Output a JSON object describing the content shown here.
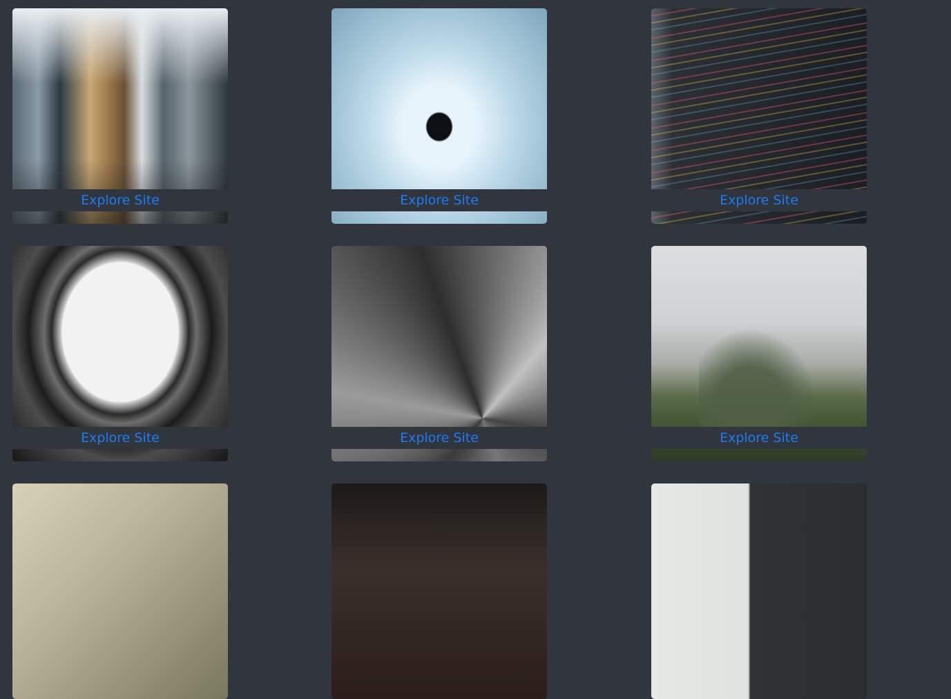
{
  "gallery": {
    "cards": [
      {
        "link_label": "Explore Site",
        "image": "city-skyscrapers"
      },
      {
        "link_label": "Explore Site",
        "image": "light-corridor"
      },
      {
        "link_label": "Explore Site",
        "image": "code-screen"
      },
      {
        "link_label": "Explore Site",
        "image": "curved-building"
      },
      {
        "link_label": "Explore Site",
        "image": "swirl-architecture"
      },
      {
        "link_label": "Explore Site",
        "image": "misty-mountain"
      },
      {
        "image": "foggy-tower"
      },
      {
        "image": "dark-interior"
      },
      {
        "image": "plant-window"
      }
    ]
  },
  "colors": {
    "background": "#30353e",
    "link": "#1f7bf0"
  }
}
